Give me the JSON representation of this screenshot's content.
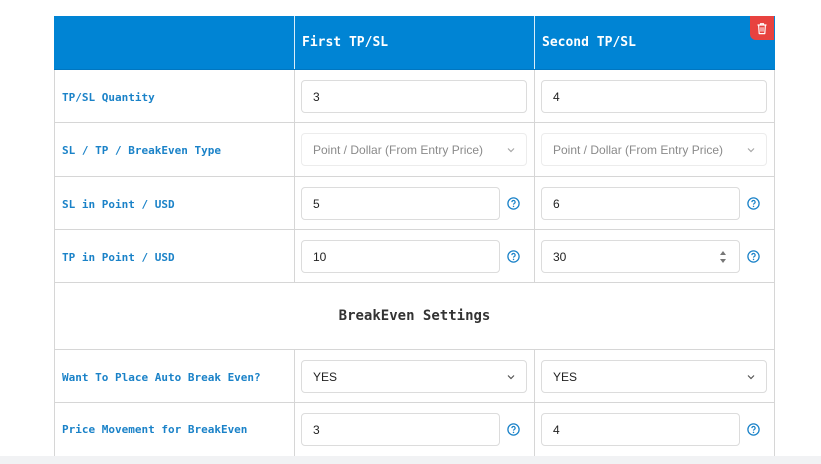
{
  "table": {
    "header": {
      "col0": "",
      "col1": "First TP/SL",
      "col2": "Second TP/SL"
    },
    "rows": [
      {
        "label": "TP/SL Quantity",
        "first": "3",
        "second": "4"
      },
      {
        "label": "SL / TP / BreakEven Type",
        "first": "Point / Dollar (From Entry Price)",
        "second": "Point / Dollar (From Entry Price)"
      },
      {
        "label": "SL in Point / USD",
        "first": "5",
        "second": "6"
      },
      {
        "label": "TP in Point / USD",
        "first": "10",
        "second": "30"
      }
    ],
    "section_title": "BreakEven Settings",
    "breakeven_rows": [
      {
        "label": "Want To Place Auto Break Even?",
        "first": "YES",
        "second": "YES"
      },
      {
        "label": "Price Movement for BreakEven",
        "first": "3",
        "second": "4"
      }
    ]
  },
  "colors": {
    "header_bg": "#0084d4",
    "label_text": "#1a82c8",
    "delete_button": "#e8423f",
    "help_icon": "#1a82c8"
  },
  "icons": {
    "delete": "trash-icon",
    "help": "question-circle-icon",
    "dropdown": "chevron-down-icon",
    "spinner": "spin-arrows-icon"
  }
}
